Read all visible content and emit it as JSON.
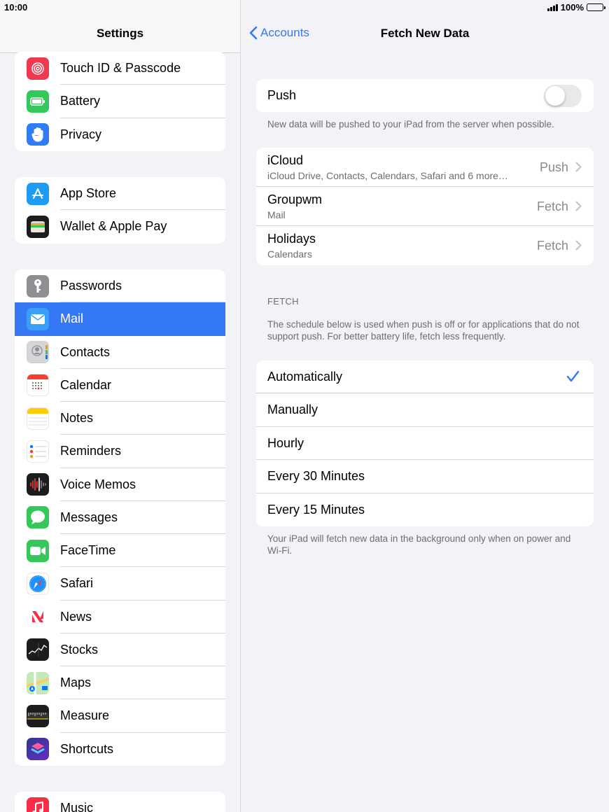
{
  "status_bar": {
    "time": "10:00",
    "battery": "100%"
  },
  "sidebar": {
    "title": "Settings",
    "groups": [
      {
        "items": [
          {
            "label": "Touch ID & Passcode",
            "icon": "fingerprint-icon",
            "color": "#f0384f"
          },
          {
            "label": "Battery",
            "icon": "battery-icon",
            "color": "#34c759"
          },
          {
            "label": "Privacy",
            "icon": "hand-icon",
            "color": "#2f7cf6"
          }
        ]
      },
      {
        "items": [
          {
            "label": "App Store",
            "icon": "app-store-icon",
            "color": "#1e9bf5"
          },
          {
            "label": "Wallet & Apple Pay",
            "icon": "wallet-icon",
            "color": "#1c1c1e"
          }
        ]
      },
      {
        "items": [
          {
            "label": "Passwords",
            "icon": "key-icon",
            "color": "#8e8e93"
          },
          {
            "label": "Mail",
            "icon": "mail-icon",
            "color": "#3aa0f7"
          },
          {
            "label": "Contacts",
            "icon": "contacts-icon",
            "color": "#c9c9ce"
          },
          {
            "label": "Calendar",
            "icon": "calendar-icon",
            "color": "#ffffff"
          },
          {
            "label": "Notes",
            "icon": "notes-icon",
            "color": "#ffffff"
          },
          {
            "label": "Reminders",
            "icon": "reminders-icon",
            "color": "#ffffff"
          },
          {
            "label": "Voice Memos",
            "icon": "waveform-icon",
            "color": "#1c1c1e"
          },
          {
            "label": "Messages",
            "icon": "message-bubble-icon",
            "color": "#34c759"
          },
          {
            "label": "FaceTime",
            "icon": "video-camera-icon",
            "color": "#34c759"
          },
          {
            "label": "Safari",
            "icon": "compass-icon",
            "color": "#ffffff"
          },
          {
            "label": "News",
            "icon": "news-icon",
            "color": "#ffffff"
          },
          {
            "label": "Stocks",
            "icon": "stocks-icon",
            "color": "#1c1c1e"
          },
          {
            "label": "Maps",
            "icon": "map-icon",
            "color": "#8fd18f"
          },
          {
            "label": "Measure",
            "icon": "ruler-icon",
            "color": "#1c1c1e"
          },
          {
            "label": "Shortcuts",
            "icon": "shortcuts-icon",
            "color": "#4a3ad0"
          }
        ]
      },
      {
        "items": [
          {
            "label": "Music",
            "icon": "music-note-icon",
            "color": "#fa2d48"
          }
        ]
      }
    ]
  },
  "detail": {
    "back_label": "Accounts",
    "title": "Fetch New Data",
    "push": {
      "label": "Push",
      "on": false,
      "footnote": "New data will be pushed to your iPad from the server when possible."
    },
    "accounts": [
      {
        "name": "iCloud",
        "sub": "iCloud Drive, Contacts, Calendars, Safari and 6 more…",
        "value": "Push"
      },
      {
        "name": "Groupwm",
        "sub": "Mail",
        "value": "Fetch"
      },
      {
        "name": "Holidays",
        "sub": "Calendars",
        "value": "Fetch"
      }
    ],
    "fetch_header": "FETCH",
    "fetch_description": "The schedule below is used when push is off or for applications that do not support push. For better battery life, fetch less frequently.",
    "options": [
      {
        "label": "Automatically",
        "selected": true
      },
      {
        "label": "Manually",
        "selected": false
      },
      {
        "label": "Hourly",
        "selected": false
      },
      {
        "label": "Every 30 Minutes",
        "selected": false
      },
      {
        "label": "Every 15 Minutes",
        "selected": false
      }
    ],
    "bottom_footnote": "Your iPad will fetch new data in the background only when on power and Wi-Fi.",
    "accent_color": "#3478f6"
  }
}
